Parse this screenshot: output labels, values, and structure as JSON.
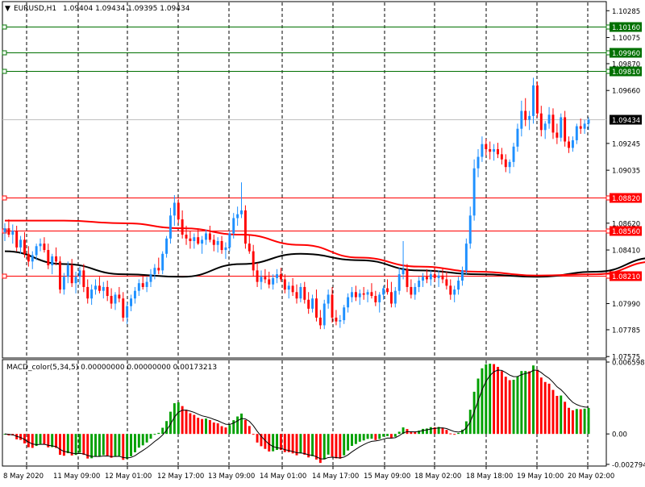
{
  "header": {
    "symbol": "EURUSD,H1",
    "ohlc": "1.09404 1.09434 1.09395 1.09434",
    "collapse_icon": "triangle-down-icon"
  },
  "price_axis": {
    "labels": [
      "1.10285",
      "1.10075",
      "1.09870",
      "1.09660",
      "1.09245",
      "1.09035",
      "1.08620",
      "1.08410",
      "1.07990",
      "1.07785",
      "1.07575"
    ],
    "levels": [
      1.10285,
      1.10075,
      1.0987,
      1.0966,
      1.09245,
      1.09035,
      1.0862,
      1.0841,
      1.0799,
      1.07785,
      1.07575
    ]
  },
  "horizontal_lines": [
    {
      "label": "1.10160",
      "price": 1.1016,
      "color": "#007000"
    },
    {
      "label": "1.09960",
      "price": 1.0996,
      "color": "#007000"
    },
    {
      "label": "1.09810",
      "price": 1.0981,
      "color": "#007000"
    },
    {
      "label": "1.08820",
      "price": 1.0882,
      "color": "#ff0000"
    },
    {
      "label": "1.08560",
      "price": 1.0856,
      "color": "#ff0000"
    },
    {
      "label": "1.08210",
      "price": 1.0821,
      "color": "#ff0000"
    }
  ],
  "current_price": {
    "label": "1.09434",
    "price": 1.09434,
    "color": "#000000"
  },
  "macd": {
    "label": "MACD_color(5,34,5) 0.00000000 0.00000000 0.00173213",
    "axis_labels": [
      "0.0065982",
      "0.00",
      "-0.002794"
    ],
    "axis_values": [
      0.0065982,
      0.0,
      -0.002794
    ]
  },
  "time_axis": {
    "labels": [
      "8 May 2020",
      "11 May 09:00",
      "12 May 01:00",
      "12 May 17:00",
      "13 May 09:00",
      "14 May 01:00",
      "14 May 17:00",
      "15 May 09:00",
      "18 May 02:00",
      "18 May 18:00",
      "19 May 10:00",
      "20 May 02:00"
    ]
  },
  "colors": {
    "bull": "#1e90ff",
    "bear": "#ff0000",
    "ma_black": "#000000",
    "ma_red": "#ff0000",
    "macd_up": "#00a000",
    "macd_down": "#ff0000"
  },
  "chart_data": {
    "type": "candlestick",
    "series": [
      {
        "name": "EURUSD,H1",
        "values": [
          [
            1.0855,
            1.0862,
            1.0848,
            1.0858
          ],
          [
            1.0858,
            1.0865,
            1.0851,
            1.0853
          ],
          [
            1.0853,
            1.0861,
            1.0846,
            1.0856
          ],
          [
            1.0856,
            1.086,
            1.084,
            1.0843
          ],
          [
            1.0843,
            1.0852,
            1.0838,
            1.0849
          ],
          [
            1.0849,
            1.0855,
            1.0835,
            1.0838
          ],
          [
            1.0838,
            1.0844,
            1.0828,
            1.0832
          ],
          [
            1.0832,
            1.084,
            1.0826,
            1.0837
          ],
          [
            1.0837,
            1.0846,
            1.0833,
            1.0844
          ],
          [
            1.0844,
            1.085,
            1.084,
            1.0846
          ],
          [
            1.0846,
            1.0851,
            1.0839,
            1.0841
          ],
          [
            1.0841,
            1.0846,
            1.0826,
            1.0829
          ],
          [
            1.0829,
            1.0838,
            1.0822,
            1.0836
          ],
          [
            1.0836,
            1.0843,
            1.0829,
            1.0832
          ],
          [
            1.0832,
            1.0836,
            1.0807,
            1.081
          ],
          [
            1.081,
            1.0823,
            1.0806,
            1.082
          ],
          [
            1.082,
            1.0832,
            1.0815,
            1.0829
          ],
          [
            1.0829,
            1.0834,
            1.0812,
            1.0815
          ],
          [
            1.0815,
            1.0824,
            1.0807,
            1.082
          ],
          [
            1.082,
            1.0828,
            1.0814,
            1.0825
          ],
          [
            1.0825,
            1.083,
            1.0808,
            1.0812
          ],
          [
            1.0812,
            1.0818,
            1.0799,
            1.0803
          ],
          [
            1.0803,
            1.0814,
            1.0798,
            1.081
          ],
          [
            1.081,
            1.0818,
            1.0806,
            1.0813
          ],
          [
            1.0813,
            1.082,
            1.0807,
            1.0809
          ],
          [
            1.0809,
            1.0816,
            1.0803,
            1.0812
          ],
          [
            1.0812,
            1.0817,
            1.0801,
            1.0805
          ],
          [
            1.0805,
            1.0811,
            1.0795,
            1.0799
          ],
          [
            1.0799,
            1.0808,
            1.0794,
            1.0806
          ],
          [
            1.0806,
            1.0812,
            1.08,
            1.0803
          ],
          [
            1.0803,
            1.0808,
            1.0785,
            1.0788
          ],
          [
            1.0788,
            1.08,
            1.0783,
            1.0797
          ],
          [
            1.0797,
            1.0806,
            1.0793,
            1.0803
          ],
          [
            1.0803,
            1.0812,
            1.0799,
            1.0809
          ],
          [
            1.0809,
            1.0818,
            1.0805,
            1.0815
          ],
          [
            1.0815,
            1.0821,
            1.081,
            1.0812
          ],
          [
            1.0812,
            1.082,
            1.0808,
            1.0816
          ],
          [
            1.0816,
            1.0826,
            1.0812,
            1.0822
          ],
          [
            1.0822,
            1.083,
            1.0818,
            1.0827
          ],
          [
            1.0827,
            1.0835,
            1.0822,
            1.0825
          ],
          [
            1.0825,
            1.084,
            1.0822,
            1.0838
          ],
          [
            1.0838,
            1.0852,
            1.0835,
            1.085
          ],
          [
            1.085,
            1.0874,
            1.0846,
            1.0868
          ],
          [
            1.0868,
            1.0884,
            1.086,
            1.0878
          ],
          [
            1.0878,
            1.0881,
            1.0862,
            1.0865
          ],
          [
            1.0865,
            1.0872,
            1.085,
            1.0853
          ],
          [
            1.0853,
            1.086,
            1.0845,
            1.085
          ],
          [
            1.085,
            1.0856,
            1.0842,
            1.0848
          ],
          [
            1.0848,
            1.0854,
            1.0842,
            1.0851
          ],
          [
            1.0851,
            1.0858,
            1.0845,
            1.0846
          ],
          [
            1.0846,
            1.0852,
            1.0838,
            1.0849
          ],
          [
            1.0849,
            1.0857,
            1.0845,
            1.0854
          ],
          [
            1.0854,
            1.086,
            1.0847,
            1.0849
          ],
          [
            1.0849,
            1.0853,
            1.084,
            1.0845
          ],
          [
            1.0845,
            1.0851,
            1.0839,
            1.0848
          ],
          [
            1.0848,
            1.0852,
            1.0838,
            1.0841
          ],
          [
            1.0841,
            1.0847,
            1.0834,
            1.0843
          ],
          [
            1.0843,
            1.0856,
            1.084,
            1.0854
          ],
          [
            1.0854,
            1.087,
            1.085,
            1.0866
          ],
          [
            1.0866,
            1.0875,
            1.086,
            1.0869
          ],
          [
            1.0869,
            1.0894,
            1.0866,
            1.0872
          ],
          [
            1.0872,
            1.0876,
            1.0842,
            1.0846
          ],
          [
            1.0846,
            1.0853,
            1.0838,
            1.084
          ],
          [
            1.084,
            1.0845,
            1.082,
            1.0825
          ],
          [
            1.0825,
            1.0831,
            1.0812,
            1.0816
          ],
          [
            1.0816,
            1.0825,
            1.081,
            1.082
          ],
          [
            1.082,
            1.0826,
            1.0815,
            1.0818
          ],
          [
            1.0818,
            1.0824,
            1.0811,
            1.0814
          ],
          [
            1.0814,
            1.0822,
            1.081,
            1.0819
          ],
          [
            1.0819,
            1.0826,
            1.0815,
            1.0822
          ],
          [
            1.0822,
            1.0827,
            1.0816,
            1.0818
          ],
          [
            1.0818,
            1.0822,
            1.0807,
            1.081
          ],
          [
            1.081,
            1.0816,
            1.0803,
            1.0813
          ],
          [
            1.0813,
            1.0819,
            1.0805,
            1.0808
          ],
          [
            1.0808,
            1.0814,
            1.0799,
            1.0803
          ],
          [
            1.0803,
            1.0815,
            1.08,
            1.0812
          ],
          [
            1.0812,
            1.0816,
            1.0799,
            1.0802
          ],
          [
            1.0802,
            1.0808,
            1.0791,
            1.0795
          ],
          [
            1.0795,
            1.0806,
            1.0792,
            1.0803
          ],
          [
            1.0803,
            1.081,
            1.0785,
            1.0788
          ],
          [
            1.0788,
            1.0794,
            1.0779,
            1.0782
          ],
          [
            1.0782,
            1.0802,
            1.0779,
            1.0799
          ],
          [
            1.0799,
            1.081,
            1.0795,
            1.0806
          ],
          [
            1.0806,
            1.0812,
            1.0784,
            1.0788
          ],
          [
            1.0788,
            1.0794,
            1.0782,
            1.0785
          ],
          [
            1.0785,
            1.079,
            1.078,
            1.0786
          ],
          [
            1.0786,
            1.0798,
            1.0783,
            1.0796
          ],
          [
            1.0796,
            1.0807,
            1.0792,
            1.0804
          ],
          [
            1.0804,
            1.0812,
            1.08,
            1.0808
          ],
          [
            1.0808,
            1.0813,
            1.0801,
            1.0804
          ],
          [
            1.0804,
            1.081,
            1.0798,
            1.0807
          ],
          [
            1.0807,
            1.0812,
            1.0802,
            1.0806
          ],
          [
            1.0806,
            1.081,
            1.08,
            1.0808
          ],
          [
            1.0808,
            1.0815,
            1.0803,
            1.0805
          ],
          [
            1.0805,
            1.0809,
            1.0797,
            1.08
          ],
          [
            1.08,
            1.0808,
            1.0792,
            1.0806
          ],
          [
            1.0806,
            1.0813,
            1.0802,
            1.0811
          ],
          [
            1.0811,
            1.0818,
            1.0806,
            1.0808
          ],
          [
            1.0808,
            1.0816,
            1.0796,
            1.0799
          ],
          [
            1.0799,
            1.0812,
            1.0796,
            1.0809
          ],
          [
            1.0809,
            1.0827,
            1.0806,
            1.0822
          ],
          [
            1.0822,
            1.0848,
            1.0818,
            1.0826
          ],
          [
            1.0826,
            1.083,
            1.0808,
            1.0812
          ],
          [
            1.0812,
            1.0818,
            1.0803,
            1.0806
          ],
          [
            1.0806,
            1.0815,
            1.0802,
            1.0812
          ],
          [
            1.0812,
            1.082,
            1.0808,
            1.0817
          ],
          [
            1.0817,
            1.0823,
            1.0812,
            1.082
          ],
          [
            1.082,
            1.0826,
            1.0815,
            1.0818
          ],
          [
            1.0818,
            1.0825,
            1.0813,
            1.0822
          ],
          [
            1.0822,
            1.0828,
            1.0816,
            1.0819
          ],
          [
            1.0819,
            1.0825,
            1.0812,
            1.0821
          ],
          [
            1.0821,
            1.0827,
            1.0815,
            1.0818
          ],
          [
            1.0818,
            1.0824,
            1.081,
            1.0813
          ],
          [
            1.0813,
            1.0818,
            1.0802,
            1.0806
          ],
          [
            1.0806,
            1.0813,
            1.08,
            1.081
          ],
          [
            1.081,
            1.082,
            1.0806,
            1.0817
          ],
          [
            1.0817,
            1.0828,
            1.0813,
            1.0825
          ],
          [
            1.0825,
            1.085,
            1.0822,
            1.0846
          ],
          [
            1.0846,
            1.0875,
            1.0842,
            1.0868
          ],
          [
            1.0868,
            1.0912,
            1.0864,
            1.0905
          ],
          [
            1.0905,
            1.092,
            1.0898,
            1.0914
          ],
          [
            1.0914,
            1.093,
            1.091,
            1.0924
          ],
          [
            1.0924,
            1.0928,
            1.0915,
            1.092
          ],
          [
            1.092,
            1.0926,
            1.0912,
            1.0918
          ],
          [
            1.0918,
            1.0924,
            1.0911,
            1.092
          ],
          [
            1.092,
            1.0925,
            1.0913,
            1.0916
          ],
          [
            1.0916,
            1.0921,
            1.0908,
            1.0912
          ],
          [
            1.0912,
            1.0916,
            1.0902,
            1.0906
          ],
          [
            1.0906,
            1.0912,
            1.0901,
            1.091
          ],
          [
            1.091,
            1.0925,
            1.0906,
            1.0922
          ],
          [
            1.0922,
            1.094,
            1.0918,
            1.0936
          ],
          [
            1.0936,
            1.0958,
            1.093,
            1.095
          ],
          [
            1.095,
            1.096,
            1.0938,
            1.0943
          ],
          [
            1.0943,
            1.095,
            1.0935,
            1.0946
          ],
          [
            1.0946,
            1.0976,
            1.094,
            1.097
          ],
          [
            1.097,
            1.0973,
            1.0945,
            1.0948
          ],
          [
            1.0948,
            1.0954,
            1.093,
            1.0935
          ],
          [
            1.0935,
            1.0942,
            1.0928,
            1.094
          ],
          [
            1.094,
            1.0953,
            1.0936,
            1.0947
          ],
          [
            1.0947,
            1.0952,
            1.0928,
            1.0933
          ],
          [
            1.0933,
            1.094,
            1.0924,
            1.0929
          ],
          [
            1.0929,
            1.0948,
            1.0926,
            1.0945
          ],
          [
            1.0945,
            1.095,
            1.0922,
            1.0926
          ],
          [
            1.0926,
            1.093,
            1.0917,
            1.0921
          ],
          [
            1.0921,
            1.093,
            1.0918,
            1.0927
          ],
          [
            1.0927,
            1.094,
            1.0924,
            1.0938
          ],
          [
            1.0938,
            1.0944,
            1.0932,
            1.0936
          ],
          [
            1.0936,
            1.0943,
            1.0932,
            1.094
          ],
          [
            1.094,
            1.0945,
            1.0935,
            1.0943
          ]
        ]
      }
    ],
    "moving_averages": [
      {
        "name": "black",
        "values": [
          [
            0,
            1.084
          ],
          [
            15,
            1.083
          ],
          [
            30,
            1.0822
          ],
          [
            45,
            1.082
          ],
          [
            60,
            1.083
          ],
          [
            75,
            1.0838
          ],
          [
            90,
            1.0833
          ],
          [
            105,
            1.0825
          ],
          [
            120,
            1.0822
          ],
          [
            135,
            1.082
          ],
          [
            150,
            1.0824
          ],
          [
            165,
            1.0835
          ],
          [
            182,
            1.0857
          ]
        ]
      },
      {
        "name": "red",
        "values": [
          [
            0,
            1.0864
          ],
          [
            15,
            1.0864
          ],
          [
            30,
            1.0862
          ],
          [
            45,
            1.0858
          ],
          [
            60,
            1.0853
          ],
          [
            75,
            1.0845
          ],
          [
            90,
            1.0835
          ],
          [
            105,
            1.0828
          ],
          [
            120,
            1.0824
          ],
          [
            135,
            1.0821
          ],
          [
            150,
            1.0822
          ],
          [
            165,
            1.0832
          ],
          [
            182,
            1.0847
          ]
        ]
      }
    ],
    "ylim": [
      1.0757,
      1.1035
    ],
    "macd_histogram_ylim": [
      -0.0028,
      0.0066
    ]
  }
}
